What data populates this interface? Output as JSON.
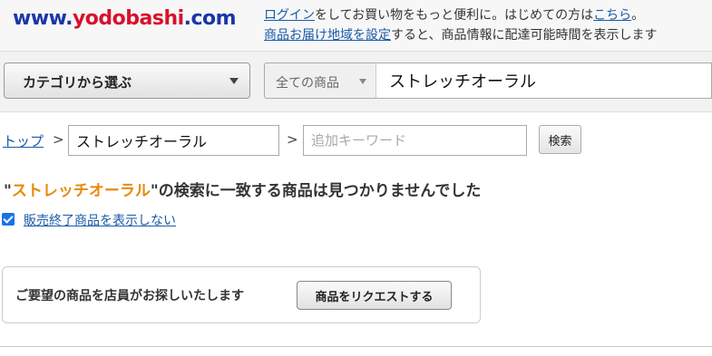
{
  "header": {
    "logo": {
      "www": "www.",
      "brand": "yodobashi",
      "com": ".com"
    },
    "login_link": "ログイン",
    "line1_middle": "をしてお買い物をもっと便利に。はじめての方は",
    "here_link": "こちら",
    "line1_end": "。",
    "area_link": "商品お届け地域を設定",
    "line2_rest": "すると、商品情報に配達可能時間を表示します"
  },
  "searchbar": {
    "category_label": "カテゴリから選ぶ",
    "scope_label": "全ての商品",
    "query": "ストレッチオーラル"
  },
  "breadcrumb": {
    "top_link": "トップ",
    "separator": ">",
    "keyword_value": "ストレッチオーラル",
    "additional_placeholder": "追加キーワード",
    "search_button": "検索"
  },
  "result": {
    "quote_open": "\"",
    "keyword": "ストレッチオーラル",
    "message": "\"の検索に一致する商品は見つかりませんでした"
  },
  "filter": {
    "hide_discontinued_label": "販売終了商品を表示しない",
    "checked": true
  },
  "request": {
    "text": "ご要望の商品を店員がお探しいたします",
    "button": "商品をリクエストする"
  },
  "colors": {
    "accent_keyword": "#e88a0c",
    "link": "#1a5aa8",
    "logo_blue": "#1a37a8",
    "logo_red": "#d9102a",
    "checkbox": "#1a73e8"
  }
}
